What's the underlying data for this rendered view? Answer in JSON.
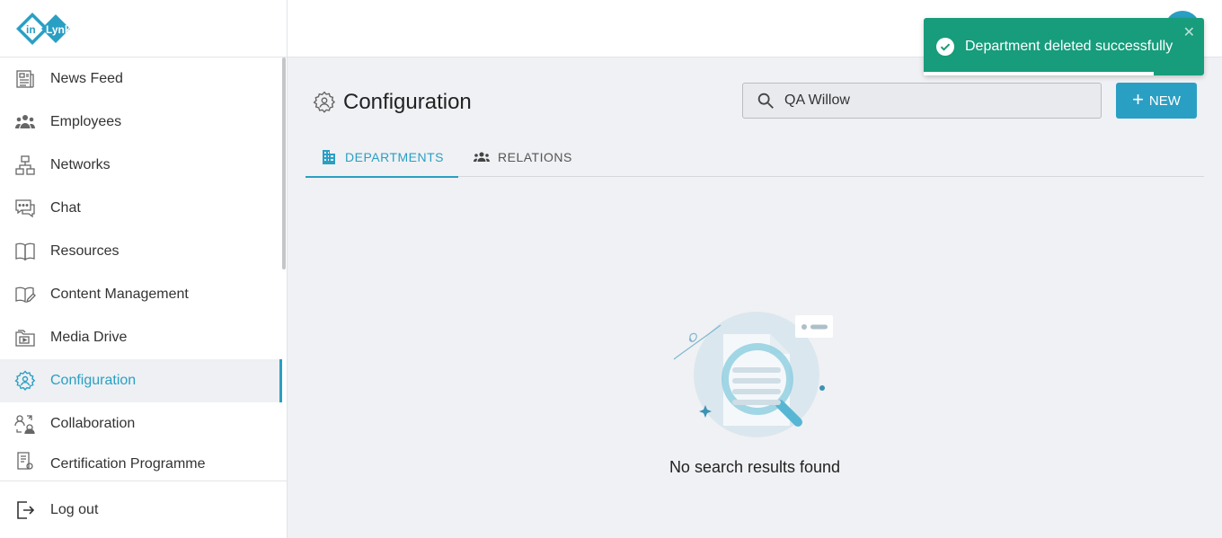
{
  "brand": {
    "logo_text_in": "in",
    "logo_text_lynk": "Lynk"
  },
  "sidebar": {
    "items": [
      {
        "label": "News Feed",
        "icon": "newspaper-icon"
      },
      {
        "label": "Employees",
        "icon": "people-icon"
      },
      {
        "label": "Networks",
        "icon": "network-icon"
      },
      {
        "label": "Chat",
        "icon": "chat-icon"
      },
      {
        "label": "Resources",
        "icon": "book-icon"
      },
      {
        "label": "Content Management",
        "icon": "content-icon"
      },
      {
        "label": "Media Drive",
        "icon": "media-drive-icon"
      },
      {
        "label": "Configuration",
        "icon": "gear-person-icon",
        "active": true
      },
      {
        "label": "Collaboration",
        "icon": "collaboration-icon"
      },
      {
        "label": "Certification Programme",
        "icon": "certificate-icon"
      }
    ],
    "logout_label": "Log out"
  },
  "main": {
    "title": "Configuration",
    "search": {
      "value": "QA Willow",
      "placeholder": ""
    },
    "new_button_label": "NEW",
    "tabs": [
      {
        "label": "DEPARTMENTS",
        "active": true
      },
      {
        "label": "RELATIONS",
        "active": false
      }
    ],
    "empty_text": "No search results found"
  },
  "toast": {
    "message": "Department deleted successfully",
    "close": "✕",
    "progress": 0.82
  },
  "colors": {
    "accent": "#2a9fc4",
    "toast": "#179c7c",
    "background": "#f0f1f4"
  }
}
